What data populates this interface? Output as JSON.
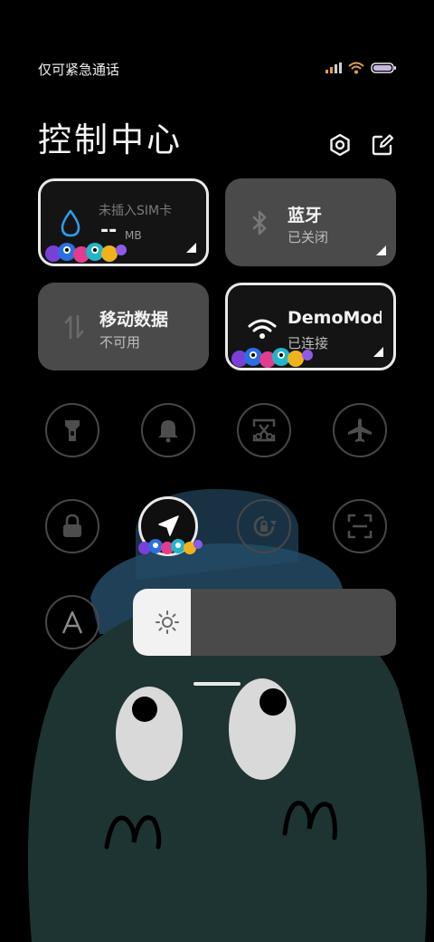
{
  "status_bar": {
    "carrier_text": "仅可紧急通话",
    "icons": [
      "signal-icon",
      "wifi-icon",
      "battery-icon"
    ]
  },
  "header": {
    "title": "控制中心",
    "icons": [
      "settings-icon",
      "edit-icon"
    ]
  },
  "tiles": {
    "data_usage": {
      "label": "未插入SIM卡",
      "value": "--",
      "unit": "MB",
      "icon": "water-drop-icon",
      "state": "active"
    },
    "bluetooth": {
      "title": "蓝牙",
      "status": "已关闭",
      "icon": "bluetooth-icon",
      "state": "off"
    },
    "mobile_data": {
      "title": "移动数据",
      "status": "不可用",
      "icon": "data-transfer-icon",
      "state": "disabled"
    },
    "wifi": {
      "title": "DemoMod",
      "status": "已连接",
      "icon": "wifi-icon",
      "state": "active"
    }
  },
  "toggles": [
    {
      "name": "flashlight",
      "icon": "flashlight-icon",
      "active": false
    },
    {
      "name": "sound",
      "icon": "bell-icon",
      "active": false
    },
    {
      "name": "screenshot",
      "icon": "screenshot-icon",
      "active": false
    },
    {
      "name": "airplane-mode",
      "icon": "airplane-icon",
      "active": false
    },
    {
      "name": "lock-screen",
      "icon": "lock-icon",
      "active": false
    },
    {
      "name": "location",
      "icon": "location-arrow-icon",
      "active": true
    },
    {
      "name": "auto-rotate",
      "icon": "rotation-lock-icon",
      "active": false
    },
    {
      "name": "scanner",
      "icon": "scan-icon",
      "active": false
    },
    {
      "name": "auto-brightness",
      "icon": "letter-a-icon",
      "active": false
    }
  ],
  "brightness": {
    "level_percent": 22,
    "icon": "sun-icon"
  },
  "colors": {
    "accent_blue": "#2f9be8",
    "tile_gray": "#4a4a4a",
    "active_border": "#e9e9e9",
    "ghost": "#1f3534"
  }
}
